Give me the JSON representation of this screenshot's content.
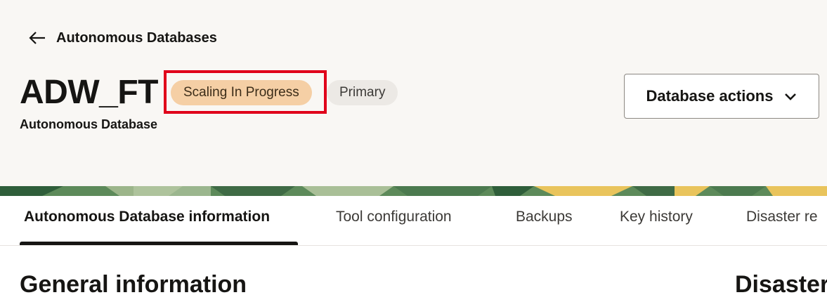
{
  "breadcrumb": {
    "back_label": "Autonomous Databases",
    "back_icon": "arrow-left-icon"
  },
  "header": {
    "title": "ADW_FT",
    "subtitle": "Autonomous Database",
    "badges": [
      {
        "label": "Scaling In Progress",
        "color": "#f5cfa5"
      },
      {
        "label": "Primary",
        "color": "#ece9e5"
      }
    ],
    "actions_button": {
      "label": "Database actions",
      "icon": "chevron-down-icon"
    }
  },
  "tabs": [
    {
      "label": "Autonomous Database information",
      "active": true
    },
    {
      "label": "Tool configuration",
      "active": false
    },
    {
      "label": "Backups",
      "active": false
    },
    {
      "label": "Key history",
      "active": false
    },
    {
      "label": "Disaster re",
      "active": false
    }
  ],
  "sections": {
    "left_title": "General information",
    "right_title": "Disaster"
  },
  "colors": {
    "highlight": "#e0001a",
    "header_bg": "#f9f7f4",
    "banner_green": "#5d8a5a",
    "banner_yellow": "#e9c45c"
  }
}
